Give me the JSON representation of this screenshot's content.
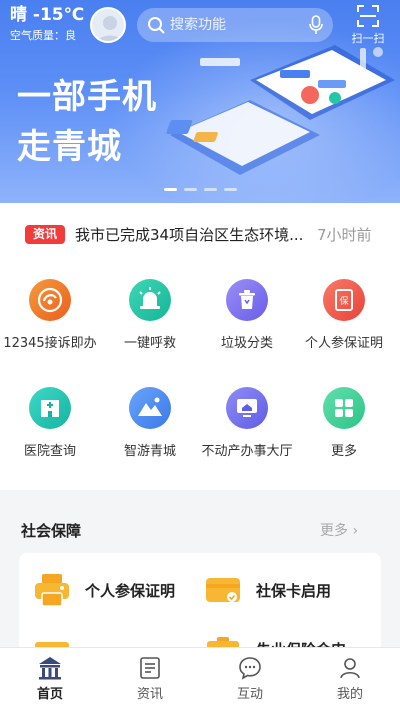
{
  "header": {
    "weather": "晴 -15℃",
    "air_quality": "空气质量：良",
    "search_placeholder": "搜索功能",
    "scan_label": "扫一扫"
  },
  "banner": {
    "line1": "一部手机",
    "line2": "走青城",
    "slide_count": 4,
    "active_slide": 1
  },
  "news": {
    "tag": "资讯",
    "headline": "我市已完成34项自治区生态环境...",
    "time": "7小时前"
  },
  "services": [
    {
      "label": "12345接诉即办",
      "icon": "complaint-icon",
      "color": "#f07a2a"
    },
    {
      "label": "一键呼救",
      "icon": "siren-icon",
      "color": "#24c6a8"
    },
    {
      "label": "垃圾分类",
      "icon": "trash-icon",
      "color": "#7a6ef0"
    },
    {
      "label": "个人参保证明",
      "icon": "insurance-doc-icon",
      "color": "#f2574a"
    },
    {
      "label": "医院查询",
      "icon": "hospital-icon",
      "color": "#22c5b4"
    },
    {
      "label": "智游青城",
      "icon": "mountain-icon",
      "color": "#4a8cf0"
    },
    {
      "label": "不动产办事大厅",
      "icon": "monitor-house-icon",
      "color": "#6e6cf0"
    },
    {
      "label": "更多",
      "icon": "grid-more-icon",
      "color": "#44d39a"
    }
  ],
  "section": {
    "title": "社会保障",
    "more": "更多",
    "items": [
      {
        "label": "个人参保证明",
        "icon": "printer-icon"
      },
      {
        "label": "社保卡启用",
        "icon": "card-icon"
      },
      {
        "label": "",
        "icon": "folder-icon"
      },
      {
        "label": "失业保险金申",
        "icon": "clipboard-icon"
      }
    ]
  },
  "nav": {
    "tabs": [
      {
        "label": "首页",
        "icon": "home-icon",
        "active": true
      },
      {
        "label": "资讯",
        "icon": "news-icon",
        "active": false
      },
      {
        "label": "互动",
        "icon": "chat-icon",
        "active": false
      },
      {
        "label": "我的",
        "icon": "user-icon",
        "active": false
      }
    ]
  },
  "colors": {
    "banner_blue": "#4a7ff0",
    "news_tag_red": "#f23b3b",
    "card_orange": "#f5a623"
  }
}
